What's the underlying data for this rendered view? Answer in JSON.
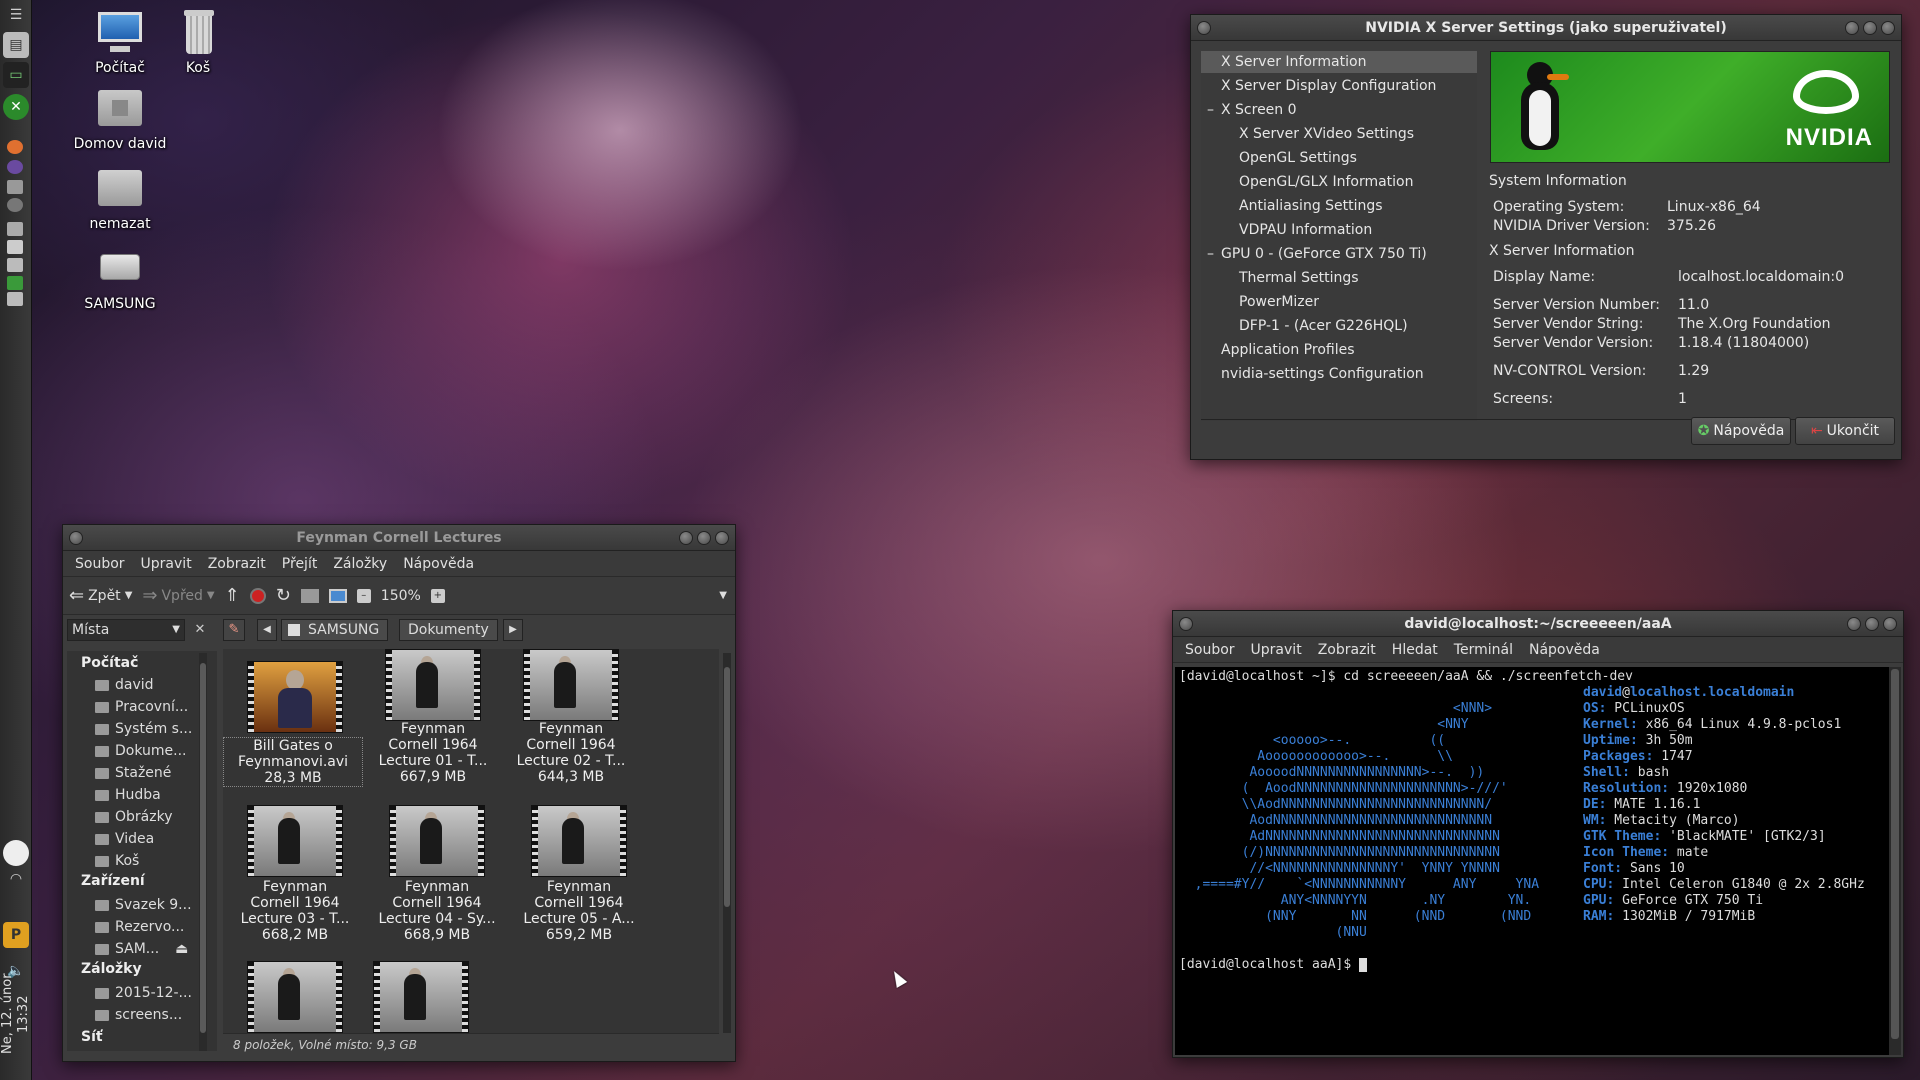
{
  "clock": {
    "date": "Ne, 12. únor",
    "time": "13:32"
  },
  "desktop": {
    "icons": [
      "Počítač",
      "Koš",
      "Domov david",
      "nemazat",
      "SAMSUNG"
    ]
  },
  "nvidia": {
    "title": "NVIDIA X Server Settings (jako superuživatel)",
    "tree": [
      "X Server Information",
      "X Server Display Configuration",
      "X Screen 0",
      "X Server XVideo Settings",
      "OpenGL Settings",
      "OpenGL/GLX Information",
      "Antialiasing Settings",
      "VDPAU Information",
      "GPU 0 - (GeForce GTX 750 Ti)",
      "Thermal Settings",
      "PowerMizer",
      "DFP-1 - (Acer G226HQL)",
      "Application Profiles",
      "nvidia-settings Configuration"
    ],
    "logo_text": "NVIDIA",
    "system_info_heading": "System Information",
    "os_label": "Operating System:",
    "os_value": "Linux-x86_64",
    "driver_label": "NVIDIA Driver Version:",
    "driver_value": "375.26",
    "xserver_heading": "X Server Information",
    "display_label": "Display Name:",
    "display_value": "localhost.localdomain:0",
    "svn_label": "Server Version Number:",
    "svn_value": "11.0",
    "svs_label": "Server Vendor String:",
    "svs_value": "The X.Org Foundation",
    "svv_label": "Server Vendor Version:",
    "svv_value": "1.18.4 (11804000)",
    "nvc_label": "NV-CONTROL Version:",
    "nvc_value": "1.29",
    "screens_label": "Screens:",
    "screens_value": "1",
    "help_button": "Nápověda",
    "quit_button": "Ukončit"
  },
  "filemanager": {
    "title": "Feynman Cornell Lectures",
    "menu": [
      "Soubor",
      "Upravit",
      "Zobrazit",
      "Přejít",
      "Záložky",
      "Nápověda"
    ],
    "back": "Zpět",
    "forward": "Vpřed",
    "zoom": "150%",
    "places_select": "Místa",
    "path": [
      "SAMSUNG",
      "Dokumenty"
    ],
    "sidebar": {
      "computer_heading": "Počítač",
      "computer_items": [
        "david",
        "Pracovní...",
        "Systém s...",
        "Dokume...",
        "Stažené",
        "Hudba",
        "Obrázky",
        "Videa",
        "Koš"
      ],
      "devices_heading": "Zařízení",
      "devices_items": [
        "Svazek 9...",
        "Rezervo...",
        "SAM..."
      ],
      "bookmarks_heading": "Záložky",
      "bookmarks_items": [
        "2015-12-...",
        "screens..."
      ],
      "network_heading": "Síť"
    },
    "files": [
      {
        "name": [
          "Bill Gates o",
          "Feynmanovi.avi"
        ],
        "size": "28,3 MB"
      },
      {
        "name": [
          "Feynman",
          "Cornell 1964",
          "Lecture 01 - T..."
        ],
        "size": "667,9 MB"
      },
      {
        "name": [
          "Feynman",
          "Cornell 1964",
          "Lecture 02 - T..."
        ],
        "size": "644,3 MB"
      },
      {
        "name": [
          "Feynman",
          "Cornell 1964",
          "Lecture 03 - T..."
        ],
        "size": "668,2 MB"
      },
      {
        "name": [
          "Feynman",
          "Cornell 1964",
          "Lecture 04 - Sy..."
        ],
        "size": "668,9 MB"
      },
      {
        "name": [
          "Feynman",
          "Cornell 1964",
          "Lecture 05 - A..."
        ],
        "size": "659,2 MB"
      }
    ],
    "status": "8 položek, Volné místo: 9,3 GB"
  },
  "terminal": {
    "title": "david@localhost:~/screeeeen/aaA",
    "menu": [
      "Soubor",
      "Upravit",
      "Zobrazit",
      "Hledat",
      "Terminál",
      "Nápověda"
    ],
    "command_line": "[david@localhost ~]$ cd screeeeen/aaA && ./screenfetch-dev",
    "ascii": [
      "                                   <NNN>",
      "                                 <NNY",
      "            <ooooo>--.          ((",
      "          Aoooooooooooo>--.      \\\\",
      "         AoooodNNNNNNNNNNNNNNNN>--.  ))",
      "        (  AoodNNNNNNNNNNNNNNNNNNNNN>-///'",
      "        \\\\AodNNNNNNNNNNNNNNNNNNNNNNNNNN/",
      "         AodNNNNNNNNNNNNNNNNNNNNNNNNNNNN",
      "         AdNNNNNNNNNNNNNNNNNNNNNNNNNNNNNN",
      "        (/)NNNNNNNNNNNNNNNNNNNNNNNNNNNNNN",
      "         //<NNNNNNNNNNNNNNNY'  YNNY YNNNN",
      "  ,====#Y//    `<NNNNNNNNNNNY      ANY     YNA",
      "             ANY<NNNNYYN       .NY        YN.",
      "           (NNY       NN      (NND       (NND",
      "                    (NNU"
    ],
    "user": "david",
    "host": "localhost.localdomain",
    "info": [
      {
        "k": "OS:",
        "v": " PCLinuxOS"
      },
      {
        "k": "Kernel:",
        "v": " x86_64 Linux 4.9.8-pclos1"
      },
      {
        "k": "Uptime:",
        "v": " 3h 50m"
      },
      {
        "k": "Packages:",
        "v": " 1747"
      },
      {
        "k": "Shell:",
        "v": " bash"
      },
      {
        "k": "Resolution:",
        "v": " 1920x1080"
      },
      {
        "k": "DE:",
        "v": " MATE 1.16.1"
      },
      {
        "k": "WM:",
        "v": " Metacity (Marco)"
      },
      {
        "k": "GTK Theme:",
        "v": " 'BlackMATE' [GTK2/3]"
      },
      {
        "k": "Icon Theme:",
        "v": " mate"
      },
      {
        "k": "Font:",
        "v": " Sans 10"
      },
      {
        "k": "CPU:",
        "v": " Intel Celeron G1840 @ 2x 2.8GHz"
      },
      {
        "k": "GPU:",
        "v": " GeForce GTX 750 Ti"
      },
      {
        "k": "RAM:",
        "v": " 1302MiB / 7917MiB"
      }
    ],
    "prompt": "[david@localhost aaA]$ "
  }
}
